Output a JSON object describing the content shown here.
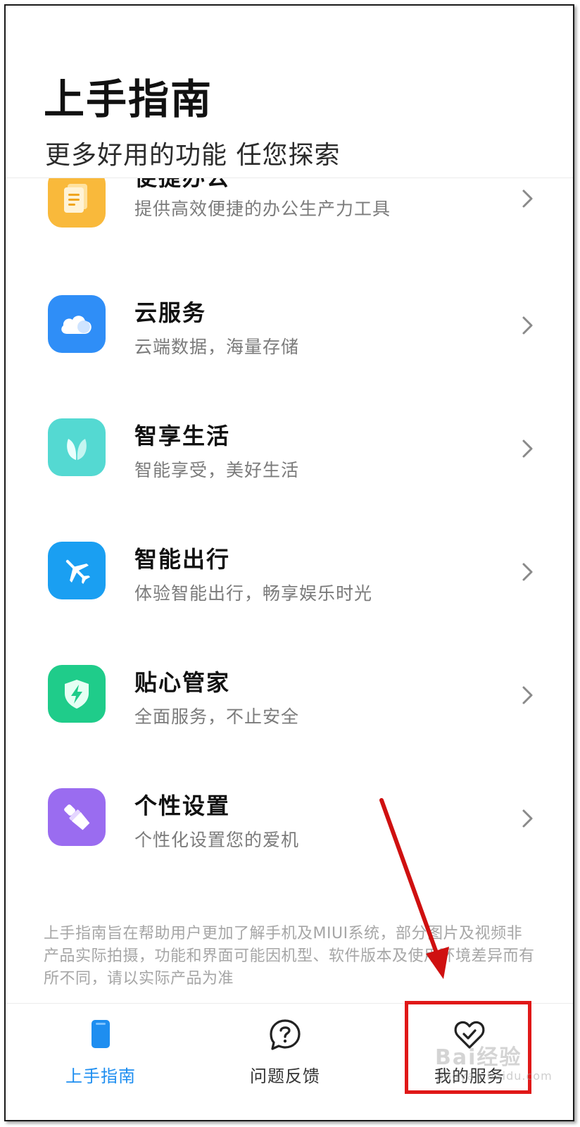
{
  "header": {
    "title": "上手指南",
    "subtitle": "更多好用的功能 任您探索"
  },
  "items": [
    {
      "title": "便捷办公",
      "desc": "提供高效便捷的办公生产力工具",
      "icon": "document-icon",
      "color": "#f9b93b"
    },
    {
      "title": "云服务",
      "desc": "云端数据，海量存储",
      "icon": "cloud-icon",
      "color": "#2f8ef7"
    },
    {
      "title": "智享生活",
      "desc": "智能享受，美好生活",
      "icon": "leaf-icon",
      "color": "#54d9d2"
    },
    {
      "title": "智能出行",
      "desc": "体验智能出行，畅享娱乐时光",
      "icon": "airplane-icon",
      "color": "#1a9ff2"
    },
    {
      "title": "贴心管家",
      "desc": "全面服务，不止安全",
      "icon": "shield-bolt-icon",
      "color": "#1fcc8a"
    },
    {
      "title": "个性设置",
      "desc": "个性化设置您的爱机",
      "icon": "brush-icon",
      "color": "#9a6cf0"
    }
  ],
  "footnote": "上手指南旨在帮助用户更加了解手机及MIUI系统，部分图片及视频非产品实际拍摄，功能和界面可能因机型、软件版本及使用环境差异而有所不同，请以实际产品为准",
  "tabs": [
    {
      "label": "上手指南",
      "icon": "phone-icon",
      "active": true
    },
    {
      "label": "问题反馈",
      "icon": "question-bubble-icon",
      "active": false
    },
    {
      "label": "我的服务",
      "icon": "heart-check-icon",
      "active": false
    }
  ],
  "watermark": {
    "text": "Bai经验",
    "url": "jingyan.baidu.com"
  },
  "colors": {
    "accent": "#1e8ef0",
    "annotation": "#e01818"
  }
}
